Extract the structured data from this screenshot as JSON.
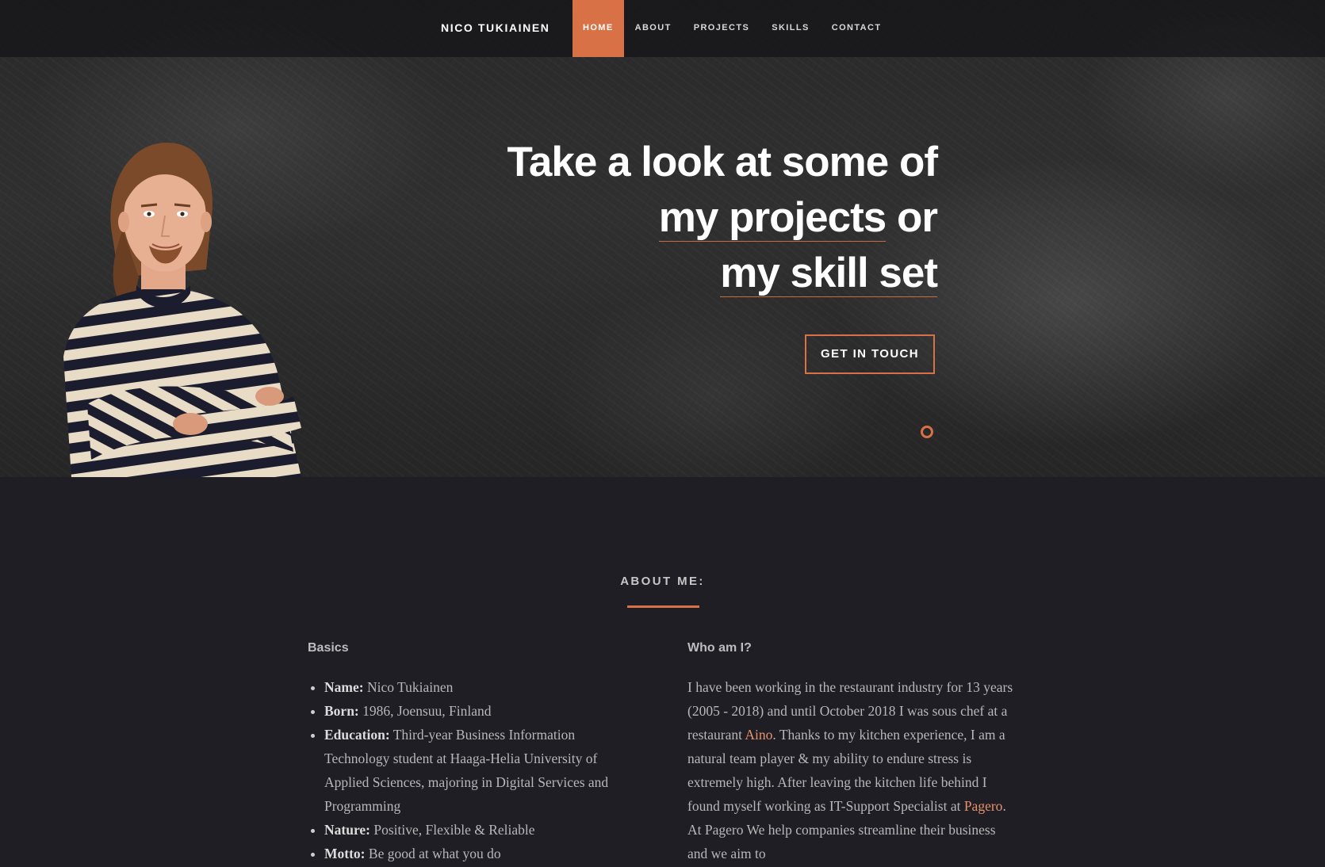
{
  "nav": {
    "brand": "NICO TUKIAINEN",
    "items": [
      {
        "label": "HOME",
        "active": true
      },
      {
        "label": "ABOUT",
        "active": false
      },
      {
        "label": "PROJECTS",
        "active": false
      },
      {
        "label": "SKILLS",
        "active": false
      },
      {
        "label": "CONTACT",
        "active": false
      }
    ]
  },
  "hero": {
    "line1": "Take a look at some of",
    "line2_link": "my projects",
    "line2_rest": " or",
    "line3_link": "my skill set",
    "cta": "GET IN TOUCH"
  },
  "about": {
    "title": "ABOUT ME:",
    "basics": {
      "heading": "Basics",
      "items": [
        {
          "label": "Name:",
          "value": " Nico Tukiainen"
        },
        {
          "label": "Born:",
          "value": " 1986, Joensuu, Finland"
        },
        {
          "label": "Education:",
          "value": " Third-year Business Information Technology student at Haaga-Helia University of Applied Sciences, majoring in Digital Services and Programming"
        },
        {
          "label": "Nature:",
          "value": " Positive, Flexible & Reliable"
        },
        {
          "label": "Motto:",
          "value": " Be good at what you do"
        }
      ]
    },
    "who": {
      "heading": "Who am I?",
      "p1": "I have been working in the restaurant industry for 13 years (2005 - 2018) and until October 2018 I was sous chef at a restaurant ",
      "link1": "Aino",
      "p2": ". Thanks to my kitchen experience, I am a natural team player & my ability to endure stress is extremely high. After leaving the kitchen life behind I found myself working as IT-Support Specialist at ",
      "link2": "Pagero",
      "p3": ". At Pagero We help companies streamline their business and we aim to"
    }
  },
  "colors": {
    "accent": "#d87145",
    "background": "#1e1e24",
    "link": "#e8926c"
  }
}
